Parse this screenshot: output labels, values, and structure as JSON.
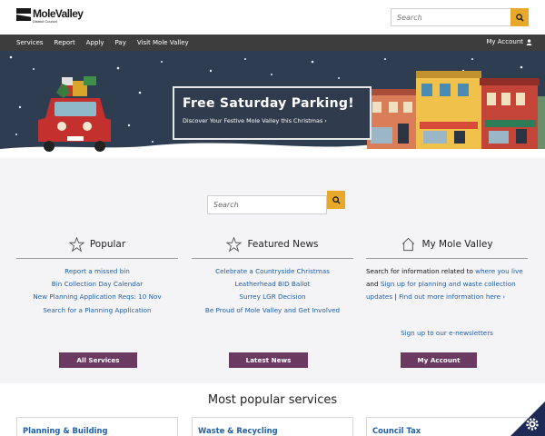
{
  "header": {
    "logo_name": "MoleValley",
    "logo_sub": "District Council",
    "search_placeholder": "Search"
  },
  "nav": {
    "items": [
      "Services",
      "Report",
      "Apply",
      "Pay",
      "Visit Mole Valley"
    ],
    "account": "My Account"
  },
  "banner": {
    "title": "Free Saturday Parking!",
    "subtitle": "Discover Your Festive Mole Valley this Christmas ›"
  },
  "main_search": {
    "placeholder": "Search"
  },
  "popular": {
    "title": "Popular",
    "links": [
      "Report a missed bin",
      "Bin Collection Day Calendar",
      "New Planning Application Reqs: 10 Nov",
      "Search for a Planning Application"
    ],
    "button": "All Services"
  },
  "featured_news": {
    "title": "Featured News",
    "links": [
      "Celebrate a Countryside Christmas",
      "Leatherhead BID Ballot",
      "Surrey LGR Decision",
      "Be Proud of Mole Valley and Get Involved"
    ],
    "button": "Latest News"
  },
  "my_mole_valley": {
    "title": "My Mole Valley",
    "text_1": "Search for information related to ",
    "link_1": "where you live",
    "text_2": " and ",
    "link_2": "Sign up for planning and waste collection updates",
    "text_3": " | ",
    "link_3": "Find out more information here ›",
    "signup": "Sign up to our e-newsletters",
    "button": "My Account"
  },
  "most_popular": {
    "title": "Most popular services",
    "services": [
      "Planning & Building",
      "Waste & Recycling",
      "Council Tax"
    ]
  },
  "colors": {
    "accent_search": "#e8a92a",
    "nav_bg": "#3d3d3d",
    "button_purple": "#6a3a60",
    "link_blue": "#1f5fa8",
    "banner_bg": "#2f3d50"
  }
}
